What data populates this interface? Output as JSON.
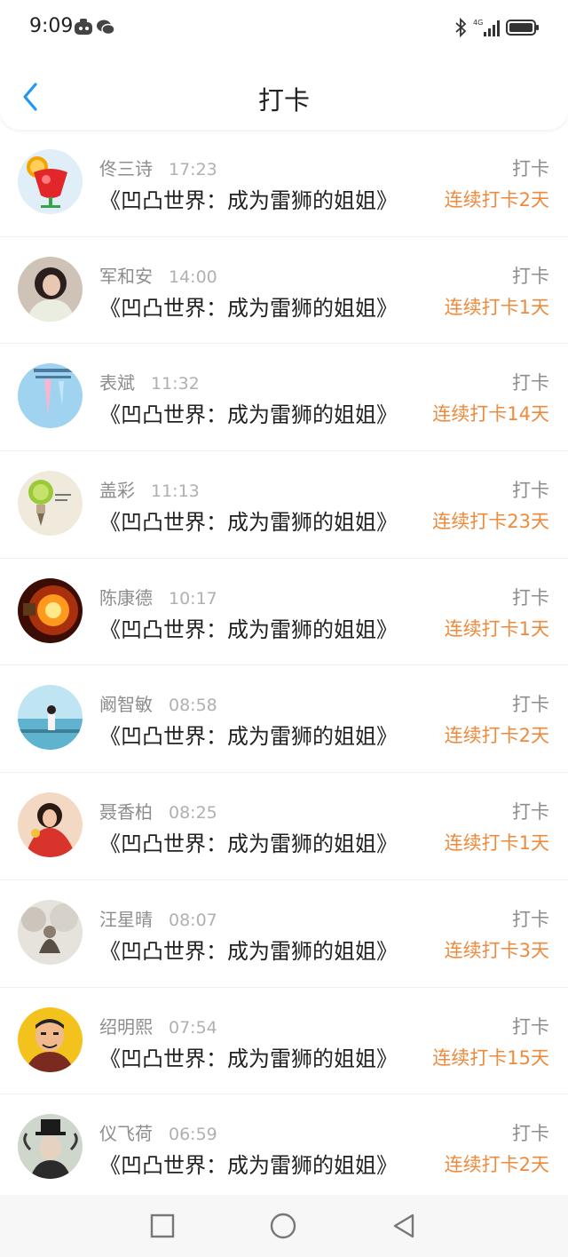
{
  "status_bar": {
    "time": "9:09",
    "network": "4G"
  },
  "header": {
    "title": "打卡"
  },
  "colors": {
    "accent": "#ef8a3c",
    "back": "#2196f3"
  },
  "records": [
    {
      "name": "佟三诗",
      "time": "17:23",
      "book": "《凹凸世界：成为雷狮的姐姐》",
      "action": "打卡",
      "streak": "连续打卡2天",
      "avatar": "drink-avatar"
    },
    {
      "name": "军和安",
      "time": "14:00",
      "book": "《凹凸世界：成为雷狮的姐姐》",
      "action": "打卡",
      "streak": "连续打卡1天",
      "avatar": "woman-avatar"
    },
    {
      "name": "表斌",
      "time": "11:32",
      "book": "《凹凸世界：成为雷狮的姐姐》",
      "action": "打卡",
      "streak": "连续打卡14天",
      "avatar": "sky-avatar"
    },
    {
      "name": "盖彩",
      "time": "11:13",
      "book": "《凹凸世界：成为雷狮的姐姐》",
      "action": "打卡",
      "streak": "连续打卡23天",
      "avatar": "lime-bulb-avatar"
    },
    {
      "name": "陈康德",
      "time": "10:17",
      "book": "《凹凸世界：成为雷狮的姐姐》",
      "action": "打卡",
      "streak": "连续打卡1天",
      "avatar": "lightbulb-avatar"
    },
    {
      "name": "阚智敏",
      "time": "08:58",
      "book": "《凹凸世界：成为雷狮的姐姐》",
      "action": "打卡",
      "streak": "连续打卡2天",
      "avatar": "seaside-avatar"
    },
    {
      "name": "聂香柏",
      "time": "08:25",
      "book": "《凹凸世界：成为雷狮的姐姐》",
      "action": "打卡",
      "streak": "连续打卡1天",
      "avatar": "girl-red-avatar"
    },
    {
      "name": "汪星晴",
      "time": "08:07",
      "book": "《凹凸世界：成为雷狮的姐姐》",
      "action": "打卡",
      "streak": "连续打卡3天",
      "avatar": "clouds-avatar"
    },
    {
      "name": "绍明熙",
      "time": "07:54",
      "book": "《凹凸世界：成为雷狮的姐姐》",
      "action": "打卡",
      "streak": "连续打卡15天",
      "avatar": "cartoon-man-avatar"
    },
    {
      "name": "仪飞荷",
      "time": "06:59",
      "book": "《凹凸世界：成为雷狮的姐姐》",
      "action": "打卡",
      "streak": "连续打卡2天",
      "avatar": "top-hat-avatar"
    }
  ]
}
